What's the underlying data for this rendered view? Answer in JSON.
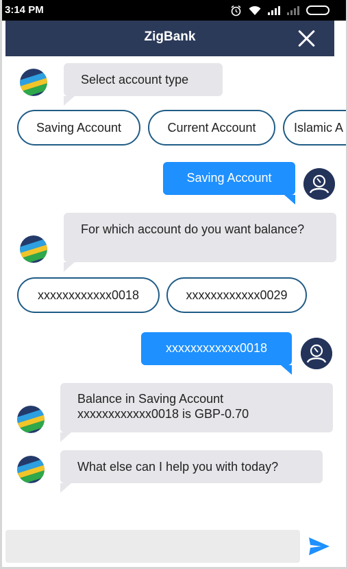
{
  "status_bar": {
    "time": "3:14 PM",
    "icons": [
      "alarm-icon",
      "wifi-icon",
      "signal-icon",
      "signal-off-icon",
      "battery-icon"
    ]
  },
  "app_bar": {
    "title": "ZigBank",
    "close_icon": "close-icon"
  },
  "messages": {
    "bot_select_account": "Select account type",
    "chips_account_type": [
      "Saving Account",
      "Current Account",
      "Islamic A"
    ],
    "user_saving": "Saving Account",
    "bot_which_account": "For which account do you want balance?",
    "chips_accounts": [
      "xxxxxxxxxxxx0018",
      "xxxxxxxxxxxx0029"
    ],
    "user_account": "xxxxxxxxxxxx0018",
    "bot_balance_line1": "Balance in Saving Account",
    "bot_balance_line2": "xxxxxxxxxxxx0018 is GBP-0.70",
    "bot_help": "What else can I help you with today?"
  },
  "composer": {
    "placeholder": "",
    "send_icon": "send-icon"
  },
  "colors": {
    "app_bar": "#2c3a5a",
    "user_bubble": "#1e90ff",
    "bot_bubble": "#e6e6ea",
    "chip_border": "#1f5c86"
  }
}
